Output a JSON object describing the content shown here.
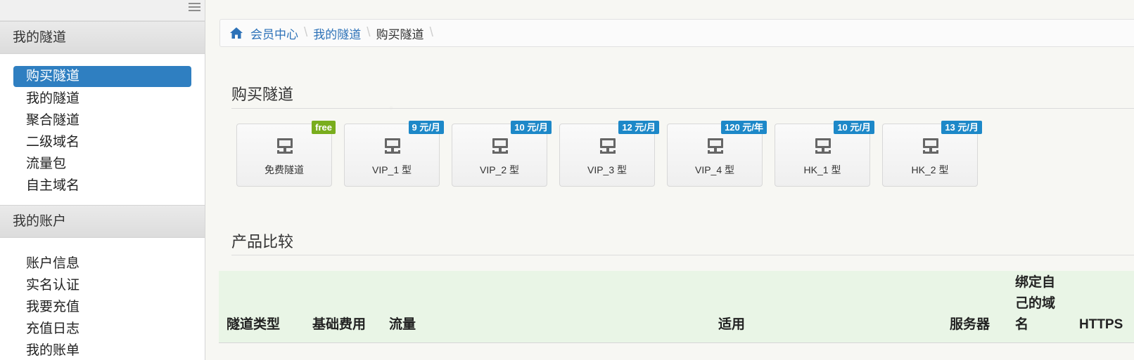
{
  "sidebar": {
    "tunnels_header": "我的隧道",
    "tunnel_items": [
      {
        "label": "购买隧道",
        "active": true
      },
      {
        "label": "我的隧道"
      },
      {
        "label": "聚合隧道"
      },
      {
        "label": "二级域名"
      },
      {
        "label": "流量包"
      },
      {
        "label": "自主域名"
      }
    ],
    "account_header": "我的账户",
    "account_items": [
      {
        "label": "账户信息"
      },
      {
        "label": "实名认证"
      },
      {
        "label": "我要充值"
      },
      {
        "label": "充值日志"
      },
      {
        "label": "我的账单"
      }
    ]
  },
  "breadcrumb": {
    "items": [
      "会员中心",
      "我的隧道",
      "购买隧道"
    ]
  },
  "main": {
    "title": "购买隧道",
    "tiles": [
      {
        "label": "免费隧道",
        "badge": "free",
        "badge_color": "#79ad1d"
      },
      {
        "label": "VIP_1 型",
        "badge": "9 元/月",
        "badge_color": "#1d88c8"
      },
      {
        "label": "VIP_2 型",
        "badge": "10 元/月",
        "badge_color": "#1d88c8"
      },
      {
        "label": "VIP_3 型",
        "badge": "12 元/月",
        "badge_color": "#1d88c8"
      },
      {
        "label": "VIP_4 型",
        "badge": "120 元/年",
        "badge_color": "#1d88c8"
      },
      {
        "label": "HK_1 型",
        "badge": "10 元/月",
        "badge_color": "#1d88c8"
      },
      {
        "label": "HK_2 型",
        "badge": "13 元/月",
        "badge_color": "#1d88c8"
      }
    ],
    "compare_title": "产品比较",
    "table_headers": [
      "隧道类型",
      "基础费用",
      "流量",
      "适用",
      "服务器",
      "绑定自己的域名",
      "HTTPS"
    ]
  },
  "colors": {
    "accent": "#2f7fc1",
    "link": "#2d72b8",
    "free_badge": "#79ad1d",
    "price_badge": "#1d88c8",
    "table_header_bg": "#e9f5e6"
  }
}
